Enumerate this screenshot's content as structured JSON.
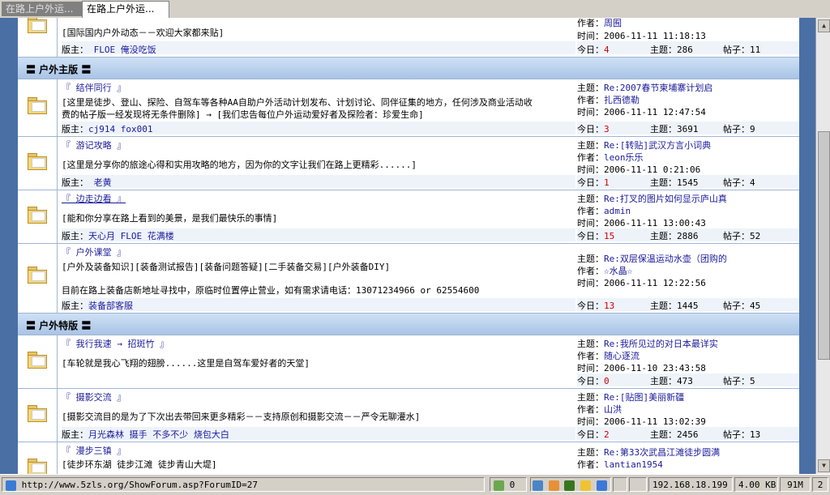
{
  "tabs": [
    {
      "label": "在路上户外运..."
    },
    {
      "label": "在路上户外运..."
    }
  ],
  "labels": {
    "moderator": "版主：",
    "today": "今日：",
    "topics": "主题：",
    "posts": "帖子：",
    "author": "作者：",
    "time": "时间：",
    "topic_prefix": "主题："
  },
  "top_partial": {
    "description": "[国际国内户外动态－－欢迎大家都来贴]",
    "moderators": "FLOE 俺没吃饭",
    "last_author": "周囿",
    "last_time": "2006-11-11 11:18:13",
    "today": "4",
    "topics": "286",
    "posts": "11"
  },
  "sections": [
    {
      "title": "〓 户外主版 〓",
      "forums": [
        {
          "name": "『 结伴同行 』",
          "description": "[这里是徒步、登山、探险、自驾车等各种AA自助户外活动计划发布、计划讨论、同伴征集的地方，任何涉及商业活动收费的帖子版一经发现将无条件删除] → [我们忠告每位户外运动爱好者及探险者：珍爱生命]",
          "desc_line1": "[这里是徒步、登山、探险、自驾车等各种AA自助户外活动计划发布、计划讨论、同伴征集的地方，任何涉及商业活动收",
          "desc_line2": "费的帖子版一经发现将无条件删除] → [我们忠告每位户外运动爱好者及探险者：珍爱生命]",
          "moderators": "cj914 fox001",
          "last_topic": "Re:2007春节柬埔寨计划启",
          "last_author": "扎西德勒",
          "last_time": "2006-11-11 12:47:54",
          "today": "3",
          "topics": "3691",
          "posts": "9"
        },
        {
          "name": "『 游记攻略 』",
          "description": "[这里是分享你的旅途心得和实用攻略的地方，因为你的文字让我们在路上更精彩......]",
          "moderators": "老黄",
          "last_topic": "Re:[转贴]武汉方言小词典",
          "last_author": "leon乐乐",
          "last_time": "2006-11-11 0:21:06",
          "today": "1",
          "topics": "1545",
          "posts": "4"
        },
        {
          "name": "『 边走边看 』",
          "description": "[能和你分享在路上看到的美景，是我们最快乐的事情]",
          "moderators": "天心月 FLOE 花满楼",
          "last_topic": "Re:打叉的图片如何显示庐山真",
          "last_author": "admin",
          "last_time": "2006-11-11 13:00:43",
          "today": "15",
          "topics": "2886",
          "posts": "52"
        },
        {
          "name": "『 户外课堂 』",
          "description": "[户外及装备知识][装备测试报告][装备问题答疑][二手装备交易][户外装备DIY]",
          "notice": "目前在路上装备店新地址寻找中，原临时位置停止营业，如有需求请电话：13071234966 or 62554600",
          "moderators": "装备部客服",
          "last_topic": "Re:双层保温运动水壶（团购的",
          "last_author": "☆水晶☆",
          "last_time": "2006-11-11 12:22:56",
          "today": "13",
          "topics": "1445",
          "posts": "45"
        }
      ]
    },
    {
      "title": "〓 户外特版 〓",
      "forums": [
        {
          "name": "『 我行我速 → 招斑竹 』",
          "description": "[车轮就是我心飞翔的翅膀......这里是自驾车爱好者的天堂]",
          "moderators": "",
          "last_topic": "Re:我所见过的对日本最详实",
          "last_author": "随心逐流",
          "last_time": "2006-11-10 23:43:58",
          "today": "0",
          "topics": "473",
          "posts": "5"
        },
        {
          "name": "『 摄影交流 』",
          "description": "[摄影交流目的是为了下次出去带回来更多精彩－－支持原创和摄影交流－－严令无聊灌水]",
          "moderators": "月光森林 摄手 不多不少 烧包大白",
          "last_topic": "Re:[贴图]美丽新疆",
          "last_author": "山洪",
          "last_time": "2006-11-11 13:02:39",
          "today": "2",
          "topics": "2456",
          "posts": "13"
        },
        {
          "name": "『 漫步三镇 』",
          "description": "[徒步环东湖  徒步江滩  徒步青山大堤]",
          "last_topic": "Re:第33次武昌江滩徒步圆满",
          "last_author": "lantian1954"
        }
      ]
    }
  ],
  "statusbar": {
    "url": "http://www.5zls.org/ShowForum.asp?ForumID=27",
    "popup_count": "0",
    "ip": "192.168.18.199",
    "speed": "4.00 KB",
    "memory": "91M",
    "windows": "2"
  },
  "colors": {
    "accent": "#4a6fa5",
    "count_red": "#d00000",
    "link_blue": "#1a1a9a"
  }
}
